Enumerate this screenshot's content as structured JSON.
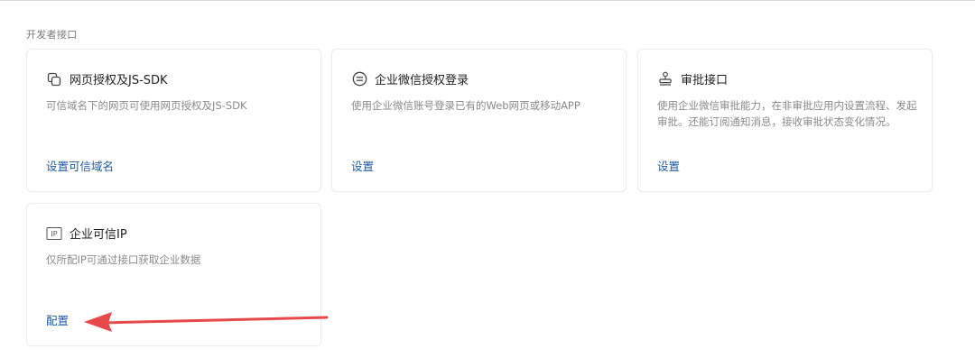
{
  "section": {
    "title": "开发者接口"
  },
  "cards": [
    {
      "icon": "copy-icon",
      "title": "网页授权及JS-SDK",
      "description": "可信域名下的网页可使用网页授权及JS-SDK",
      "link": "设置可信域名"
    },
    {
      "icon": "login-icon",
      "title": "企业微信授权登录",
      "description": "使用企业微信账号登录已有的Web网页或移动APP",
      "link": "设置"
    },
    {
      "icon": "stamp-icon",
      "title": "审批接口",
      "description": "使用企业微信审批能力，在非审批应用内设置流程、发起审批。还能订阅通知消息，接收审批状态变化情况。",
      "link": "设置"
    },
    {
      "icon": "ip-icon",
      "title": "企业可信IP",
      "description": "仅所配IP可通过接口获取企业数据",
      "link": "配置"
    }
  ],
  "colors": {
    "link": "#1f5aa8",
    "annotation_arrow": "#e8474b"
  }
}
